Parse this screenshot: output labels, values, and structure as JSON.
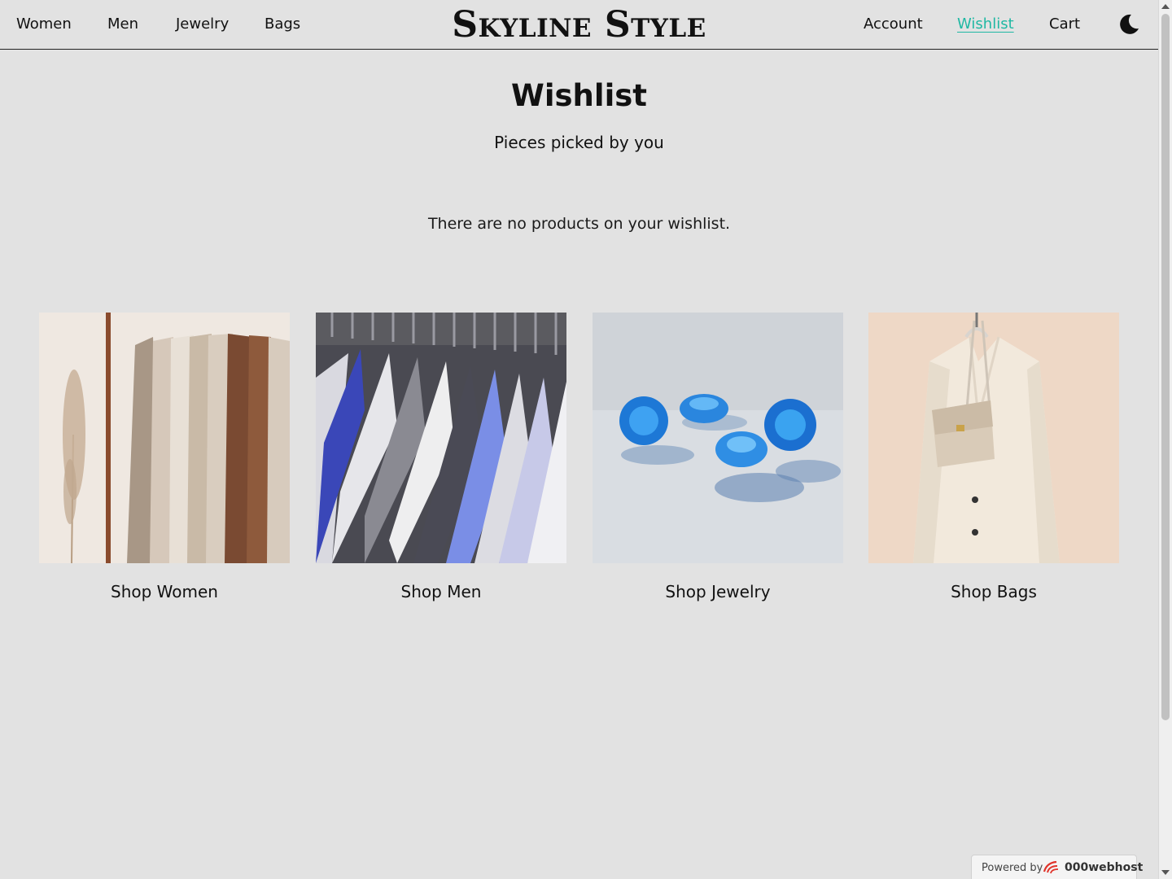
{
  "header": {
    "brand": "Skyline Style",
    "left_nav": [
      {
        "label": "Women"
      },
      {
        "label": "Men"
      },
      {
        "label": "Jewelry"
      },
      {
        "label": "Bags"
      }
    ],
    "right_nav": [
      {
        "label": "Account"
      },
      {
        "label": "Wishlist",
        "active": true
      },
      {
        "label": "Cart"
      }
    ],
    "theme_toggle_icon": "moon-icon",
    "active_color": "#1fb8a3"
  },
  "main": {
    "title": "Wishlist",
    "subtitle": "Pieces picked by you",
    "empty_message": "There are no products on your wishlist."
  },
  "categories": [
    {
      "label": "Shop Women",
      "image": "clothing-rack-neutral-tones"
    },
    {
      "label": "Shop Men",
      "image": "dress-shirts-on-hangers"
    },
    {
      "label": "Shop Jewelry",
      "image": "blue-gemstones"
    },
    {
      "label": "Shop Bags",
      "image": "handbag-on-beige-coat"
    }
  ],
  "footer_badge": {
    "prefix": "Powered by",
    "brand": "000webhost"
  }
}
